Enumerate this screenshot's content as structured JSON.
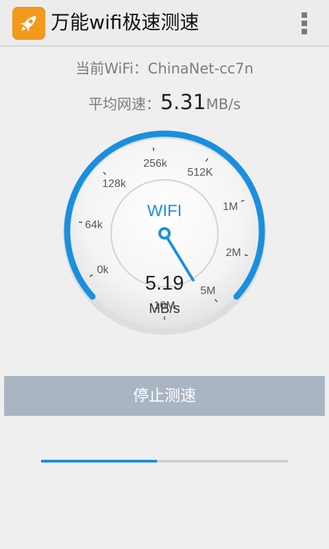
{
  "app": {
    "title": "万能wifi极速测速",
    "icon": "rocket-icon",
    "menu_icon": "overflow-menu-icon"
  },
  "info": {
    "wifi_label": "当前WiFi：",
    "wifi_name": "ChinaNet-cc7n",
    "avg_label": "平均网速：",
    "avg_value": "5.31",
    "avg_unit": "MB/s"
  },
  "gauge": {
    "label": "WIFI",
    "value": "5.19",
    "unit": "MB/s",
    "ticks": [
      "0k",
      "64k",
      "128k",
      "256k",
      "512K",
      "1M",
      "2M",
      "5M",
      "10M"
    ],
    "needle_on_tick_index": 7
  },
  "stop_button": {
    "label": "停止测速"
  },
  "progress": {
    "fraction": 0.47
  },
  "colors": {
    "accent": "#1a8fe0",
    "button": "#a9b5c3",
    "app_icon": "#f39a1d"
  }
}
